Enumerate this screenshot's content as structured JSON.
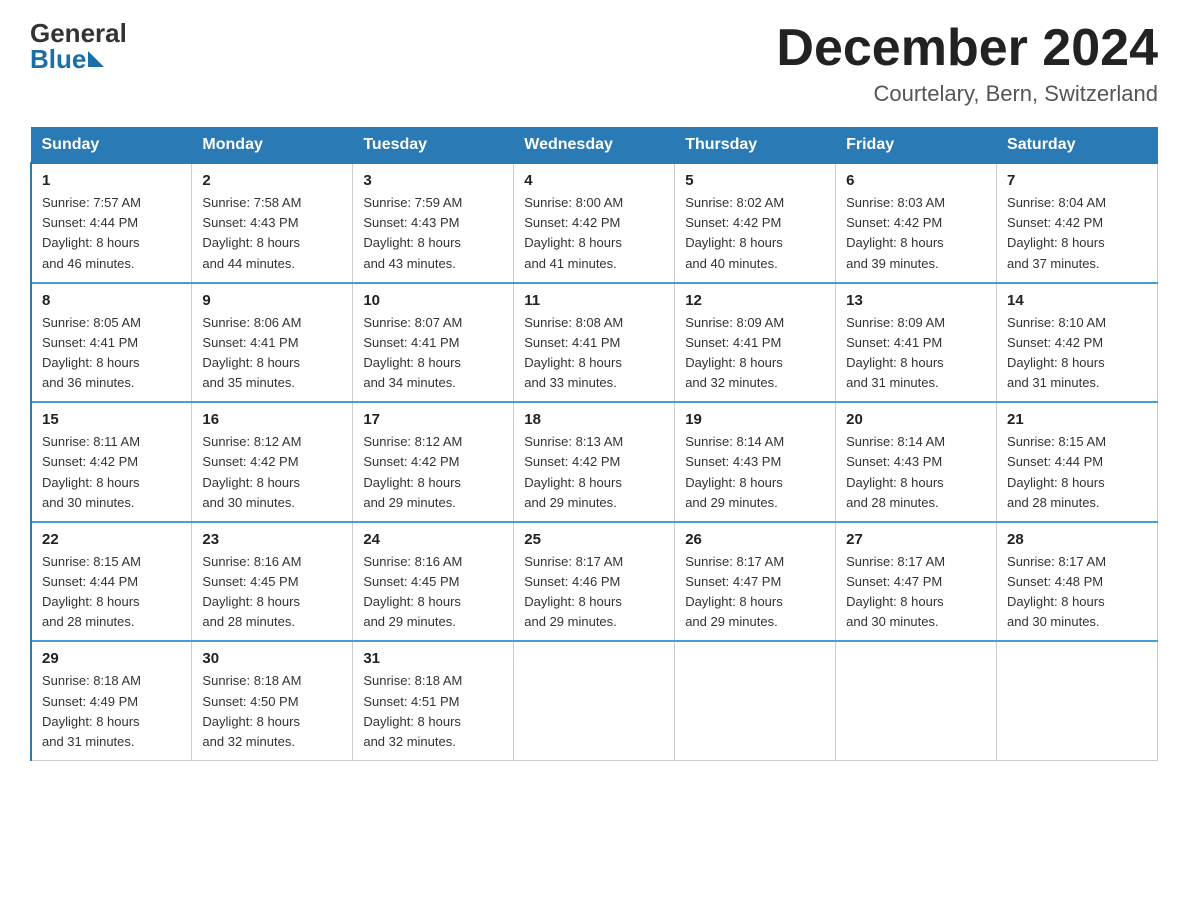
{
  "logo": {
    "general": "General",
    "blue": "Blue"
  },
  "title": "December 2024",
  "location": "Courtelary, Bern, Switzerland",
  "days_of_week": [
    "Sunday",
    "Monday",
    "Tuesday",
    "Wednesday",
    "Thursday",
    "Friday",
    "Saturday"
  ],
  "weeks": [
    [
      {
        "day": "1",
        "sunrise": "7:57 AM",
        "sunset": "4:44 PM",
        "daylight": "8 hours and 46 minutes."
      },
      {
        "day": "2",
        "sunrise": "7:58 AM",
        "sunset": "4:43 PM",
        "daylight": "8 hours and 44 minutes."
      },
      {
        "day": "3",
        "sunrise": "7:59 AM",
        "sunset": "4:43 PM",
        "daylight": "8 hours and 43 minutes."
      },
      {
        "day": "4",
        "sunrise": "8:00 AM",
        "sunset": "4:42 PM",
        "daylight": "8 hours and 41 minutes."
      },
      {
        "day": "5",
        "sunrise": "8:02 AM",
        "sunset": "4:42 PM",
        "daylight": "8 hours and 40 minutes."
      },
      {
        "day": "6",
        "sunrise": "8:03 AM",
        "sunset": "4:42 PM",
        "daylight": "8 hours and 39 minutes."
      },
      {
        "day": "7",
        "sunrise": "8:04 AM",
        "sunset": "4:42 PM",
        "daylight": "8 hours and 37 minutes."
      }
    ],
    [
      {
        "day": "8",
        "sunrise": "8:05 AM",
        "sunset": "4:41 PM",
        "daylight": "8 hours and 36 minutes."
      },
      {
        "day": "9",
        "sunrise": "8:06 AM",
        "sunset": "4:41 PM",
        "daylight": "8 hours and 35 minutes."
      },
      {
        "day": "10",
        "sunrise": "8:07 AM",
        "sunset": "4:41 PM",
        "daylight": "8 hours and 34 minutes."
      },
      {
        "day": "11",
        "sunrise": "8:08 AM",
        "sunset": "4:41 PM",
        "daylight": "8 hours and 33 minutes."
      },
      {
        "day": "12",
        "sunrise": "8:09 AM",
        "sunset": "4:41 PM",
        "daylight": "8 hours and 32 minutes."
      },
      {
        "day": "13",
        "sunrise": "8:09 AM",
        "sunset": "4:41 PM",
        "daylight": "8 hours and 31 minutes."
      },
      {
        "day": "14",
        "sunrise": "8:10 AM",
        "sunset": "4:42 PM",
        "daylight": "8 hours and 31 minutes."
      }
    ],
    [
      {
        "day": "15",
        "sunrise": "8:11 AM",
        "sunset": "4:42 PM",
        "daylight": "8 hours and 30 minutes."
      },
      {
        "day": "16",
        "sunrise": "8:12 AM",
        "sunset": "4:42 PM",
        "daylight": "8 hours and 30 minutes."
      },
      {
        "day": "17",
        "sunrise": "8:12 AM",
        "sunset": "4:42 PM",
        "daylight": "8 hours and 29 minutes."
      },
      {
        "day": "18",
        "sunrise": "8:13 AM",
        "sunset": "4:42 PM",
        "daylight": "8 hours and 29 minutes."
      },
      {
        "day": "19",
        "sunrise": "8:14 AM",
        "sunset": "4:43 PM",
        "daylight": "8 hours and 29 minutes."
      },
      {
        "day": "20",
        "sunrise": "8:14 AM",
        "sunset": "4:43 PM",
        "daylight": "8 hours and 28 minutes."
      },
      {
        "day": "21",
        "sunrise": "8:15 AM",
        "sunset": "4:44 PM",
        "daylight": "8 hours and 28 minutes."
      }
    ],
    [
      {
        "day": "22",
        "sunrise": "8:15 AM",
        "sunset": "4:44 PM",
        "daylight": "8 hours and 28 minutes."
      },
      {
        "day": "23",
        "sunrise": "8:16 AM",
        "sunset": "4:45 PM",
        "daylight": "8 hours and 28 minutes."
      },
      {
        "day": "24",
        "sunrise": "8:16 AM",
        "sunset": "4:45 PM",
        "daylight": "8 hours and 29 minutes."
      },
      {
        "day": "25",
        "sunrise": "8:17 AM",
        "sunset": "4:46 PM",
        "daylight": "8 hours and 29 minutes."
      },
      {
        "day": "26",
        "sunrise": "8:17 AM",
        "sunset": "4:47 PM",
        "daylight": "8 hours and 29 minutes."
      },
      {
        "day": "27",
        "sunrise": "8:17 AM",
        "sunset": "4:47 PM",
        "daylight": "8 hours and 30 minutes."
      },
      {
        "day": "28",
        "sunrise": "8:17 AM",
        "sunset": "4:48 PM",
        "daylight": "8 hours and 30 minutes."
      }
    ],
    [
      {
        "day": "29",
        "sunrise": "8:18 AM",
        "sunset": "4:49 PM",
        "daylight": "8 hours and 31 minutes."
      },
      {
        "day": "30",
        "sunrise": "8:18 AM",
        "sunset": "4:50 PM",
        "daylight": "8 hours and 32 minutes."
      },
      {
        "day": "31",
        "sunrise": "8:18 AM",
        "sunset": "4:51 PM",
        "daylight": "8 hours and 32 minutes."
      },
      null,
      null,
      null,
      null
    ]
  ],
  "labels": {
    "sunrise": "Sunrise:",
    "sunset": "Sunset:",
    "daylight": "Daylight:"
  }
}
